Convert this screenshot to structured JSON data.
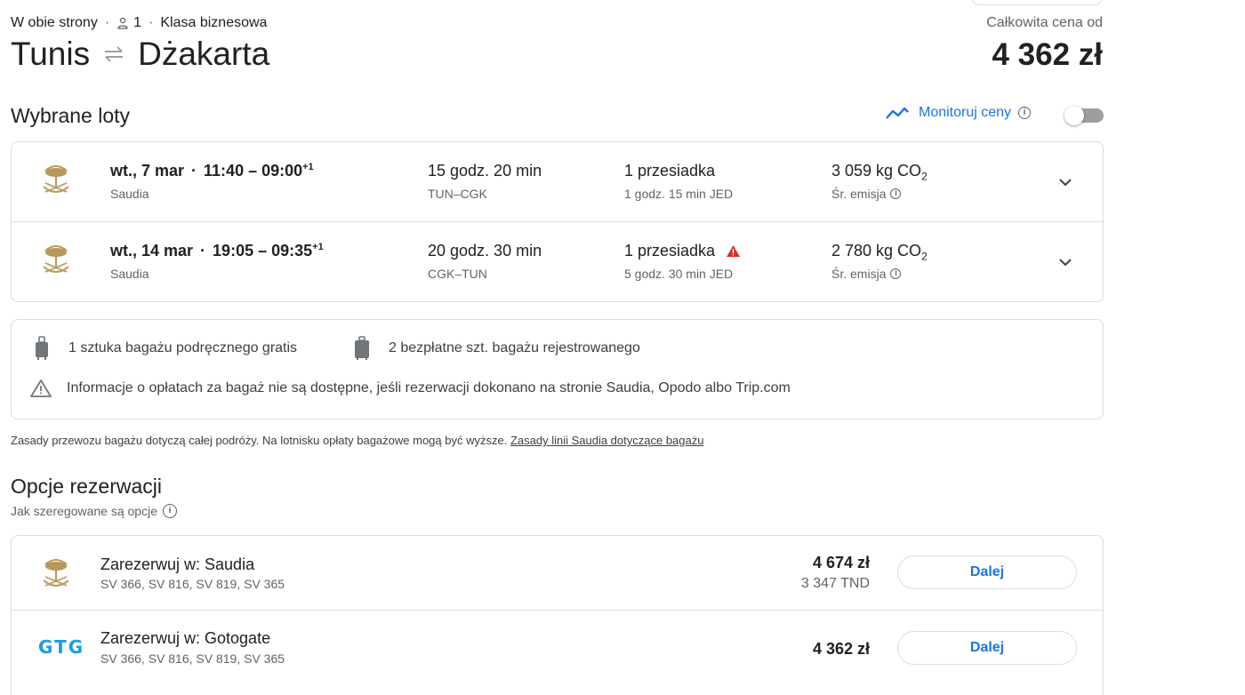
{
  "trip": {
    "type": "W obie strony",
    "passengers": "1",
    "cabin": "Klasa biznesowa",
    "origin": "Tunis",
    "destination": "Dżakarta",
    "total_label": "Całkowita cena od",
    "total_price": "4 362 zł"
  },
  "selected": {
    "title": "Wybrane loty",
    "track_label": "Monitoruj ceny",
    "flights": [
      {
        "date": "wt., 7 mar",
        "times": "11:40 – 09:00",
        "plus": "+1",
        "airline": "Saudia",
        "duration": "15 godz. 20 min",
        "route": "TUN–CGK",
        "stops": "1 przesiadka",
        "layover": "1 godz. 15 min JED",
        "emissions": "3 059 kg CO",
        "emissions_sub": "2",
        "emissions_label": "Śr. emisja"
      },
      {
        "date": "wt., 14 mar",
        "times": "19:05 – 09:35",
        "plus": "+1",
        "airline": "Saudia",
        "duration": "20 godz. 30 min",
        "route": "CGK–TUN",
        "stops": "1 przesiadka",
        "layover": "5 godz. 30 min JED",
        "emissions": "2 780 kg CO",
        "emissions_sub": "2",
        "emissions_label": "Śr. emisja"
      }
    ]
  },
  "baggage": {
    "carry_on": "1 sztuka bagażu podręcznego gratis",
    "checked": "2 bezpłatne szt. bagażu rejestrowanego",
    "warning": "Informacje o opłatach za bagaż nie są dostępne, jeśli rezerwacji dokonano na stronie Saudia, Opodo albo Trip.com",
    "policy_text": "Zasady przewozu bagażu dotyczą całej podróży. Na lotnisku opłaty bagażowe mogą być wyższe.",
    "policy_link": "Zasady linii Saudia dotyczące bagażu"
  },
  "booking": {
    "title": "Opcje rezerwacji",
    "ranking_label": "Jak szeregowane są opcje",
    "options": [
      {
        "title": "Zarezerwuj w: Saudia",
        "flights": "SV 366, SV 816, SV 819, SV 365",
        "price": "4 674 zł",
        "price_local": "3 347 TND",
        "button": "Dalej"
      },
      {
        "title": "Zarezerwuj w: Gotogate",
        "logo_text": "GTG",
        "flights": "SV 366, SV 816, SV 819, SV 365",
        "price": "4 362 zł",
        "button": "Dalej"
      }
    ]
  },
  "colors": {
    "accent": "#1a73e8",
    "border": "#dadce0",
    "warning": "#d93025",
    "saudia_gold": "#b8975a",
    "gotogate": "#1e9be3"
  }
}
